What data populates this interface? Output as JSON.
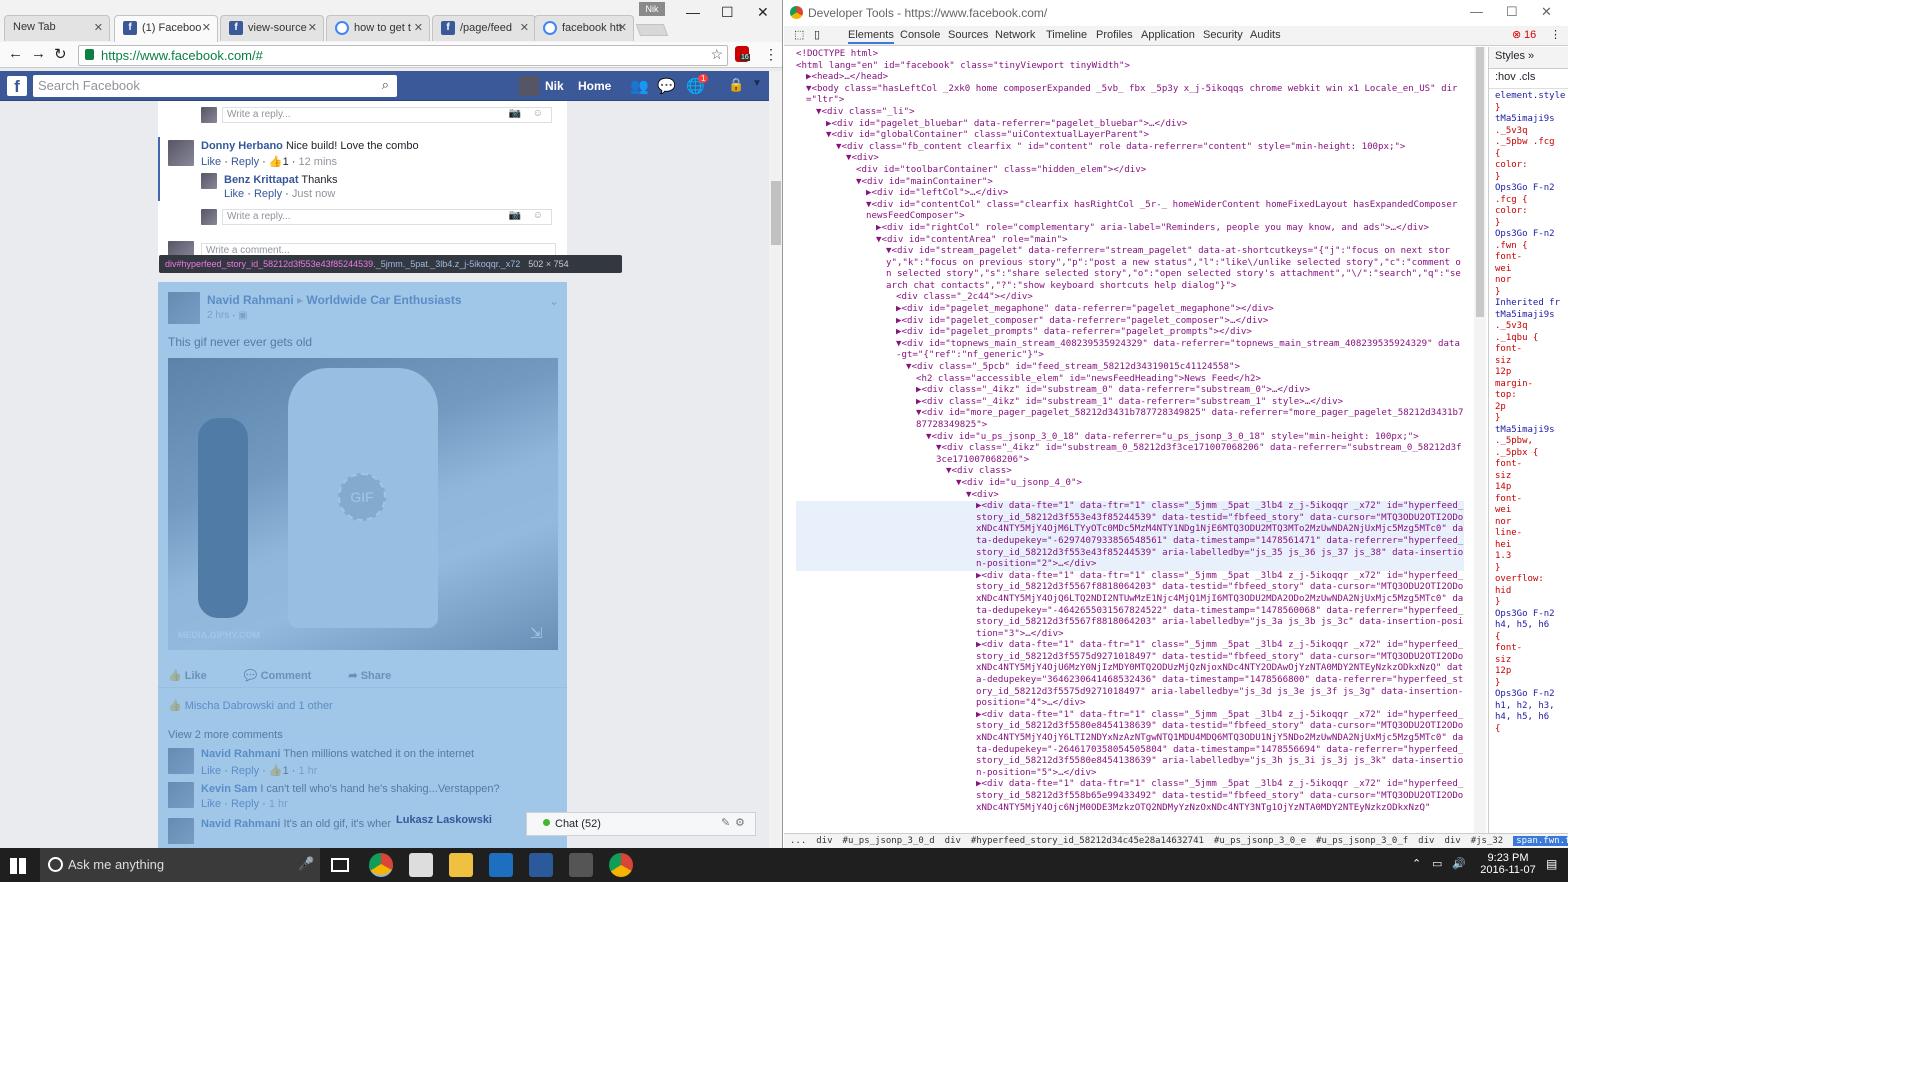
{
  "browser": {
    "tabs": [
      {
        "title": "New Tab",
        "icon": "none"
      },
      {
        "title": "(1) Faceboo",
        "icon": "facebook"
      },
      {
        "title": "view-source",
        "icon": "facebook"
      },
      {
        "title": "how to get t",
        "icon": "google"
      },
      {
        "title": "/page/feed",
        "icon": "facebook"
      },
      {
        "title": "facebook htt",
        "icon": "google"
      }
    ],
    "profile": "Nik",
    "url": "https://www.facebook.com/#",
    "ext_badge": "16"
  },
  "facebook": {
    "search_placeholder": "Search Facebook",
    "user_name": "Nik",
    "home": "Home",
    "notif_count": "1",
    "reply_placeholder_1": "Write a reply...",
    "comment1": {
      "author": "Donny Herbano",
      "text": "Nice build! Love the combo",
      "like": "Like",
      "reply": "Reply",
      "count": "1",
      "time": "12 mins"
    },
    "reply1": {
      "author": "Benz Krittapat",
      "text": "Thanks",
      "like": "Like",
      "reply": "Reply",
      "time": "Just now"
    },
    "reply_placeholder_2": "Write a reply...",
    "comment_placeholder": "Write a comment...",
    "tooltip": {
      "tag": "div",
      "id": "#hyperfeed_story_id_58212d3f553e43f85244539",
      "cls": "._5jmm._5pat._3lb4.z_j-5ikoqqr._x72",
      "size": "502 × 754"
    },
    "post": {
      "author": "Navid Rahmani",
      "group": "Worldwide Car Enthusiasts",
      "time": "2 hrs",
      "text": "This gif never ever gets old",
      "gif_label": "GIF",
      "source": "MEDIA.GIPHY.COM",
      "like": "Like",
      "comment": "Comment",
      "share": "Share",
      "reactions": "Mischa Dabrowski and 1 other",
      "view_more": "View 2 more comments",
      "c1": {
        "author": "Navid Rahmani",
        "text": "Then millions watched it on the internet",
        "like": "Like",
        "reply": "Reply",
        "count": "1",
        "time": "1 hr"
      },
      "c2": {
        "author": "Kevin Sam",
        "text": "I can't tell who's hand he's shaking...Verstappen?",
        "like": "Like",
        "reply": "Reply",
        "time": "1 hr"
      },
      "c3": {
        "author": "Navid Rahmani",
        "text": "It's an old gif, it's when Vett"
      }
    },
    "chat_name": "Lukasz Laskowski",
    "chat_label": "Chat (52)"
  },
  "devtools": {
    "title": "Developer Tools - https://www.facebook.com/",
    "tabs": [
      "Elements",
      "Console",
      "Sources",
      "Network",
      "Timeline",
      "Profiles",
      "Application",
      "Security",
      "Audits"
    ],
    "error_count": "16",
    "styles_tab": "Styles",
    "filter": ":hov .cls",
    "lines": [
      {
        "indent": 0,
        "html": "<!DOCTYPE html>"
      },
      {
        "indent": 0,
        "html": "<html lang=\"en\" id=\"facebook\" class=\"tinyViewport tinyWidth\">"
      },
      {
        "indent": 1,
        "html": "▶<head>…</head>"
      },
      {
        "indent": 1,
        "html": "▼<body class=\"hasLeftCol _2xk0 home composerExpanded _5vb_ fbx _5p3y x_j-5ikoqqs chrome webkit win x1 Locale_en_US\" dir=\"ltr\">"
      },
      {
        "indent": 2,
        "html": "▼<div class=\"_li\">"
      },
      {
        "indent": 3,
        "html": "▶<div id=\"pagelet_bluebar\" data-referrer=\"pagelet_bluebar\">…</div>"
      },
      {
        "indent": 3,
        "html": "▼<div id=\"globalContainer\" class=\"uiContextualLayerParent\">"
      },
      {
        "indent": 4,
        "html": "▼<div class=\"fb_content clearfix \" id=\"content\" role data-referrer=\"content\" style=\"min-height: 100px;\">"
      },
      {
        "indent": 5,
        "html": "▼<div>"
      },
      {
        "indent": 6,
        "html": "<div id=\"toolbarContainer\" class=\"hidden_elem\"></div>"
      },
      {
        "indent": 6,
        "html": "▼<div id=\"mainContainer\">"
      },
      {
        "indent": 7,
        "html": "▶<div id=\"leftCol\">…</div>"
      },
      {
        "indent": 7,
        "html": "▼<div id=\"contentCol\" class=\"clearfix hasRightCol _5r-_ homeWiderContent homeFixedLayout hasExpandedComposer newsFeedComposer\">"
      },
      {
        "indent": 8,
        "html": "▶<div id=\"rightCol\" role=\"complementary\" aria-label=\"Reminders, people you may know, and ads\">…</div>"
      },
      {
        "indent": 8,
        "html": "▼<div id=\"contentArea\" role=\"main\">"
      },
      {
        "indent": 9,
        "html": "▼<div id=\"stream_pagelet\" data-referrer=\"stream_pagelet\" data-at-shortcutkeys=\"{\"j\":\"focus on next story\",\"k\":\"focus on previous story\",\"p\":\"post a new status\",\"l\":\"like\\/unlike selected story\",\"c\":\"comment on selected story\",\"s\":\"share selected story\",\"o\":\"open selected story's attachment\",\"\\/\":\"search\",\"q\":\"search chat contacts\",\"?\":\"show keyboard shortcuts help dialog\"}\">"
      },
      {
        "indent": 10,
        "html": "<div class=\"_2c44\"></div>"
      },
      {
        "indent": 10,
        "html": "▶<div id=\"pagelet_megaphone\" data-referrer=\"pagelet_megaphone\"></div>"
      },
      {
        "indent": 10,
        "html": "▶<div id=\"pagelet_composer\" data-referrer=\"pagelet_composer\">…</div>"
      },
      {
        "indent": 10,
        "html": "▶<div id=\"pagelet_prompts\" data-referrer=\"pagelet_prompts\"></div>"
      },
      {
        "indent": 10,
        "html": "▼<div id=\"topnews_main_stream_408239535924329\" data-referrer=\"topnews_main_stream_408239535924329\" data-gt=\"{\"ref\":\"nf_generic\"}\">"
      },
      {
        "indent": 11,
        "html": "▼<div class=\"_5pcb\" id=\"feed_stream_58212d34319015c41124558\">"
      },
      {
        "indent": 12,
        "html": "<h2 class=\"accessible_elem\" id=\"newsFeedHeading\">News Feed</h2>"
      },
      {
        "indent": 12,
        "html": "▶<div class=\"_4ikz\" id=\"substream_0\" data-referrer=\"substream_0\">…</div>"
      },
      {
        "indent": 12,
        "html": "▶<div class=\"_4ikz\" id=\"substream_1\" data-referrer=\"substream_1\" style>…</div>"
      },
      {
        "indent": 12,
        "html": "▼<div id=\"more_pager_pagelet_58212d3431b787728349825\" data-referrer=\"more_pager_pagelet_58212d3431b787728349825\">"
      },
      {
        "indent": 13,
        "html": "▼<div id=\"u_ps_jsonp_3_0_18\" data-referrer=\"u_ps_jsonp_3_0_18\" style=\"min-height: 100px;\">"
      },
      {
        "indent": 14,
        "html": "▼<div class=\"_4ikz\" id=\"substream_0_58212d3f3ce171007068206\" data-referrer=\"substream_0_58212d3f3ce171007068206\">"
      },
      {
        "indent": 15,
        "html": "▼<div class>"
      },
      {
        "indent": 16,
        "html": "▼<div id=\"u_jsonp_4_0\">"
      },
      {
        "indent": 17,
        "html": "▼<div>"
      },
      {
        "indent": 18,
        "sel": true,
        "html": "▶<div data-fte=\"1\" data-ftr=\"1\" class=\"_5jmm _5pat _3lb4 z_j-5ikoqqr _x72\" id=\"hyperfeed_story_id_58212d3f553e43f85244539\" data-testid=\"fbfeed_story\" data-cursor=\"MTQ3ODU2OTI2ODoxNDc4NTY5MjY4OjM6LTYyOTc0MDc5MzM4NTY1NDg1NjE6MTQ3ODU2MTQ3MTo2MzUwNDA2NjUxMjc5Mzg5MTc0\" data-dedupekey=\"-6297407933856548561\" data-timestamp=\"1478561471\" data-referrer=\"hyperfeed_story_id_58212d3f553e43f85244539\" aria-labelledby=\"js_35 js_36 js_37 js_38\" data-insertion-position=\"2\">…</div>"
      },
      {
        "indent": 18,
        "html": "▶<div data-fte=\"1\" data-ftr=\"1\" class=\"_5jmm _5pat _3lb4 z_j-5ikoqqr _x72\" id=\"hyperfeed_story_id_58212d3f5567f8818064203\" data-testid=\"fbfeed_story\" data-cursor=\"MTQ3ODU2OTI2ODoxNDc4NTY5MjY4OjQ6LTQ2NDI2NTUwMzE1Njc4MjQ1MjI6MTQ3ODU2MDA2ODo2MzUwNDA2NjUxMjc5Mzg5MTc0\" data-dedupekey=\"-4642655031567824522\" data-timestamp=\"1478560068\" data-referrer=\"hyperfeed_story_id_58212d3f5567f8818064203\" aria-labelledby=\"js_3a js_3b js_3c\" data-insertion-position=\"3\">…</div>"
      },
      {
        "indent": 18,
        "html": "▶<div data-fte=\"1\" data-ftr=\"1\" class=\"_5jmm _5pat _3lb4 z_j-5ikoqqr _x72\" id=\"hyperfeed_story_id_58212d3f5575d9271018497\" data-testid=\"fbfeed_story\" data-cursor=\"MTQ3ODU2OTI2ODoxNDc4NTY5MjY4OjU6MzY0NjIzMDY0MTQ2ODUzMjQzNjoxNDc4NTY2ODAwOjYzNTA0MDY2NTEyNzkzODkxNzQ\" data-dedupekey=\"3646230641468532436\" data-timestamp=\"1478566800\" data-referrer=\"hyperfeed_story_id_58212d3f5575d9271018497\" aria-labelledby=\"js_3d js_3e js_3f js_3g\" data-insertion-position=\"4\">…</div>"
      },
      {
        "indent": 18,
        "html": "▶<div data-fte=\"1\" data-ftr=\"1\" class=\"_5jmm _5pat _3lb4 z_j-5ikoqqr _x72\" id=\"hyperfeed_story_id_58212d3f5580e8454138639\" data-testid=\"fbfeed_story\" data-cursor=\"MTQ3ODU2OTI2ODoxNDc4NTY5MjY4OjY6LTI2NDYxNzAzNTgwNTQ1MDU4MDQ6MTQ3ODU1NjY5NDo2MzUwNDA2NjUxMjc5Mzg5MTc0\" data-dedupekey=\"-2646170358054505804\" data-timestamp=\"1478556694\" data-referrer=\"hyperfeed_story_id_58212d3f5580e8454138639\" aria-labelledby=\"js_3h js_3i js_3j js_3k\" data-insertion-position=\"5\">…</div>"
      },
      {
        "indent": 18,
        "html": "▶<div data-fte=\"1\" data-ftr=\"1\" class=\"_5jmm _5pat _3lb4 z_j-5ikoqqr _x72\" id=\"hyperfeed_story_id_58212d3f558b65e99433492\" data-testid=\"fbfeed_story\" data-cursor=\"MTQ3ODU2OTI2ODoxNDc4NTY5MjY4Ojc6NjM0ODE3MzkzOTQ2NDMyYzNzOxNDc4NTY3NTg1OjYzNTA0MDY2NTEyNzkzODkxNzQ\""
      }
    ],
    "styles_lines": [
      "element.style {",
      "}",
      "tMa5imaji9s",
      "._5v3q",
      "._5pbw .fcg",
      "{",
      "  color:",
      "}",
      "Ops3Go F-n2",
      "  .fcg {",
      "  color:",
      "}",
      "Ops3Go F-n2",
      "  .fwn {",
      "  font-",
      "  wei",
      "  nor",
      "}",
      "Inherited fr",
      "tMa5imaji9s",
      "._5v3q",
      "._1qbu {",
      "  font-",
      "  siz",
      "  12p",
      "  margin-",
      "  top:",
      "  2p",
      "}",
      "tMa5imaji9s",
      "._5pbw,",
      "._5pbx {",
      "  font-",
      "  siz",
      "  14p",
      "  font-",
      "  wei",
      "  nor",
      "  line-",
      "  hei",
      "  1.3",
      "}",
      "  overflow:",
      "  hid",
      "}",
      "Ops3Go F-n2",
      "h4, h5, h6",
      "{",
      "  font-",
      "  siz",
      "  12p",
      "}",
      "Ops3Go F-n2",
      "h1, h2, h3,",
      "h4, h5, h6",
      "{"
    ],
    "crumbs": [
      "...",
      "div",
      "#u_ps_jsonp_3_0_d",
      "div",
      "#hyperfeed_story_id_58212d34c45e28a14632741",
      "#u_ps_jsonp_3_0_e",
      "#u_ps_jsonp_3_0_f",
      "div",
      "div",
      "#js_32",
      "span.fwn.fcg"
    ]
  },
  "taskbar": {
    "search": "Ask me anything",
    "time": "9:23 PM",
    "date": "2016-11-07"
  }
}
